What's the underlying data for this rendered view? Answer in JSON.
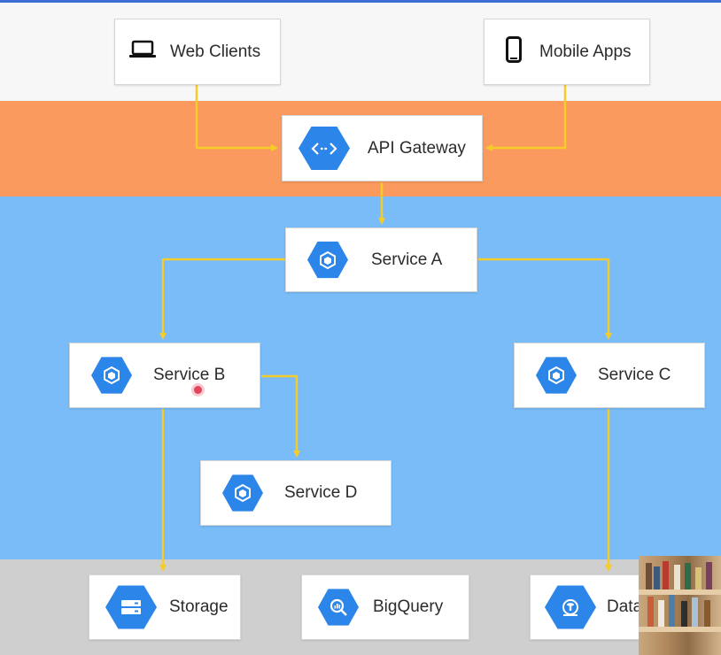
{
  "nodes": {
    "web_clients": {
      "label": "Web Clients",
      "icon": "laptop-icon"
    },
    "mobile_apps": {
      "label": "Mobile Apps",
      "icon": "smartphone-icon"
    },
    "api_gateway": {
      "label": "API Gateway",
      "icon": "api-gateway-icon"
    },
    "service_a": {
      "label": "Service A",
      "icon": "service-icon"
    },
    "service_b": {
      "label": "Service B",
      "icon": "service-icon"
    },
    "service_c": {
      "label": "Service C",
      "icon": "service-icon"
    },
    "service_d": {
      "label": "Service D",
      "icon": "service-icon"
    },
    "storage": {
      "label": "Storage",
      "icon": "storage-icon"
    },
    "bigquery": {
      "label": "BigQuery",
      "icon": "bigquery-icon"
    },
    "data": {
      "label": "Data",
      "icon": "datastore-icon"
    }
  },
  "edges": [
    [
      "web_clients",
      "api_gateway"
    ],
    [
      "mobile_apps",
      "api_gateway"
    ],
    [
      "api_gateway",
      "service_a"
    ],
    [
      "service_a",
      "service_b"
    ],
    [
      "service_a",
      "service_c"
    ],
    [
      "service_b",
      "service_d"
    ],
    [
      "service_b",
      "storage"
    ],
    [
      "service_c",
      "data"
    ]
  ],
  "colors": {
    "gateway_band": "#fb9a5e",
    "services_band": "#79bcf8",
    "data_band": "#cfcfcf",
    "icon_blue": "#2c85e8",
    "connector": "#f5cc2a"
  }
}
